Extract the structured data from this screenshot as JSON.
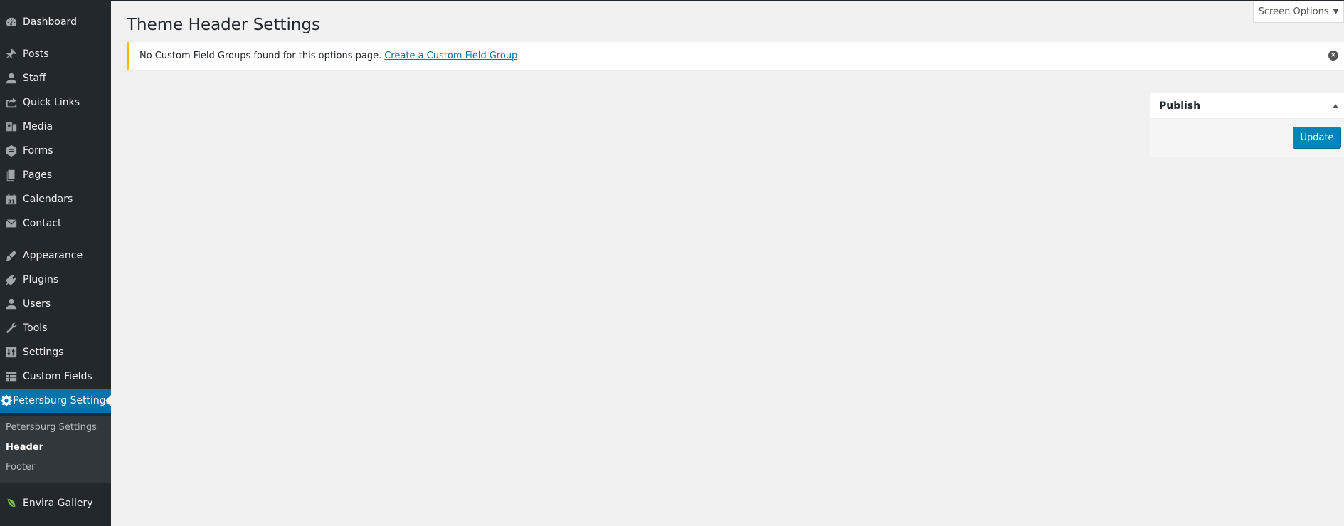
{
  "page": {
    "title": "Theme Header Settings"
  },
  "screen_options": {
    "label": "Screen Options"
  },
  "notice": {
    "text": "No Custom Field Groups found for this options page.",
    "link_text": "Create a Custom Field Group"
  },
  "sidebar": {
    "items": [
      {
        "label": "Dashboard",
        "icon": "dashboard-icon"
      },
      {
        "label": "Posts",
        "icon": "pushpin-icon"
      },
      {
        "label": "Staff",
        "icon": "person-icon"
      },
      {
        "label": "Quick Links",
        "icon": "share-icon"
      },
      {
        "label": "Media",
        "icon": "media-icon"
      },
      {
        "label": "Forms",
        "icon": "forms-icon"
      },
      {
        "label": "Pages",
        "icon": "pages-icon"
      },
      {
        "label": "Calendars",
        "icon": "calendar-icon"
      },
      {
        "label": "Contact",
        "icon": "envelope-icon"
      },
      {
        "label": "Appearance",
        "icon": "brush-icon"
      },
      {
        "label": "Plugins",
        "icon": "plug-icon"
      },
      {
        "label": "Users",
        "icon": "users-icon"
      },
      {
        "label": "Tools",
        "icon": "wrench-icon"
      },
      {
        "label": "Settings",
        "icon": "settings-icon"
      },
      {
        "label": "Custom Fields",
        "icon": "table-icon"
      },
      {
        "label": "Petersburg Settings",
        "icon": "gear-icon"
      },
      {
        "label": "Envira Gallery",
        "icon": "leaf-icon"
      }
    ],
    "submenu": [
      {
        "label": "Petersburg Settings"
      },
      {
        "label": "Header"
      },
      {
        "label": "Footer"
      }
    ]
  },
  "publish": {
    "title": "Publish",
    "update_label": "Update"
  },
  "colors": {
    "sidebar_bg": "#23282d",
    "active_bg": "#0073aa",
    "notice_border": "#ffb900",
    "button_bg": "#0085ba"
  }
}
